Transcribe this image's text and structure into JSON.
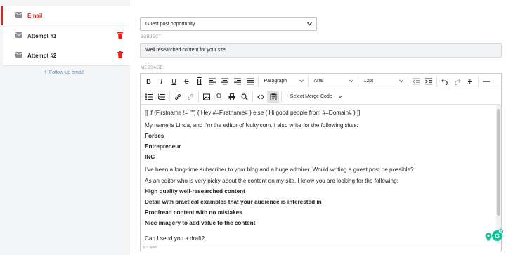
{
  "sequence": {
    "steps": [
      {
        "label": "Email",
        "active": true
      },
      {
        "label": "Attempt #1",
        "active": false
      },
      {
        "label": "Attempt #2",
        "active": false
      }
    ],
    "followup_label": "Follow-up email"
  },
  "form": {
    "opportunity_select": "Guest post opportunity",
    "subject_label": "SUBJECT",
    "subject_value": "Well researched content for your site",
    "message_label": "MESSAGE:"
  },
  "toolbar": {
    "block_format": "Paragraph",
    "font_family": "Arial",
    "font_size": "12pt",
    "merge_code": "- Select Merge Code -"
  },
  "message": {
    "lines": [
      "[[ if (Firstname != \"\") { Hey #=Firstname# } else { Hi good people from #=Domain# } ]]",
      "My name is Linda, and I’m the editor of Nulty.com.  I also write for the following sites:",
      "Forbes",
      "Entrepreneur",
      "INC",
      "I’ve been a long-time subscriber to your blog and a huge admirer. Would writing a guest post be possible?",
      "As an editor who is very picky about the content on my site, I know you are looking for the following:",
      "High quality well-researched content",
      "Detail with practical examples that your audience is interested in",
      "Proofread content with no mistakes",
      "Nice imagery to add value to the content",
      "Can I send you a draft?"
    ]
  },
  "status_path": "p » span",
  "colors": {
    "accent_red": "#e1251b",
    "grammarly_green": "#15c39a"
  }
}
